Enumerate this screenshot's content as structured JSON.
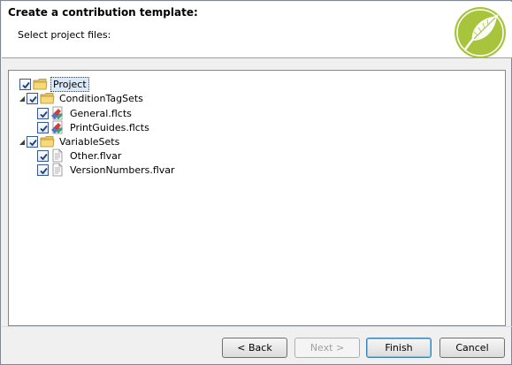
{
  "window": {
    "title": "Create a contribution template:",
    "subtitle": "Select project files:"
  },
  "tree": {
    "project": {
      "label": "Project",
      "checked": true,
      "selected": true
    },
    "condition_tag_sets": {
      "label": "ConditionTagSets",
      "checked": true,
      "expanded": true
    },
    "general": {
      "label": "General.flcts",
      "checked": true
    },
    "print_guides": {
      "label": "PrintGuides.flcts",
      "checked": true
    },
    "variable_sets": {
      "label": "VariableSets",
      "checked": true,
      "expanded": true
    },
    "other": {
      "label": "Other.flvar",
      "checked": true
    },
    "version_numbers": {
      "label": "VersionNumbers.flvar",
      "checked": true
    }
  },
  "buttons": {
    "back": "< Back",
    "next": "Next >",
    "finish": "Finish",
    "cancel": "Cancel"
  },
  "colors": {
    "logo_green": "#a8c43c",
    "folder_yellow": "#f5d97a",
    "selection": "#dbe8f8"
  },
  "icons": {
    "logo": "feather-logo-icon",
    "folder": "folder-icon",
    "condition_tag_file": "condition-tag-file-icon",
    "variable_file": "variable-file-icon"
  }
}
